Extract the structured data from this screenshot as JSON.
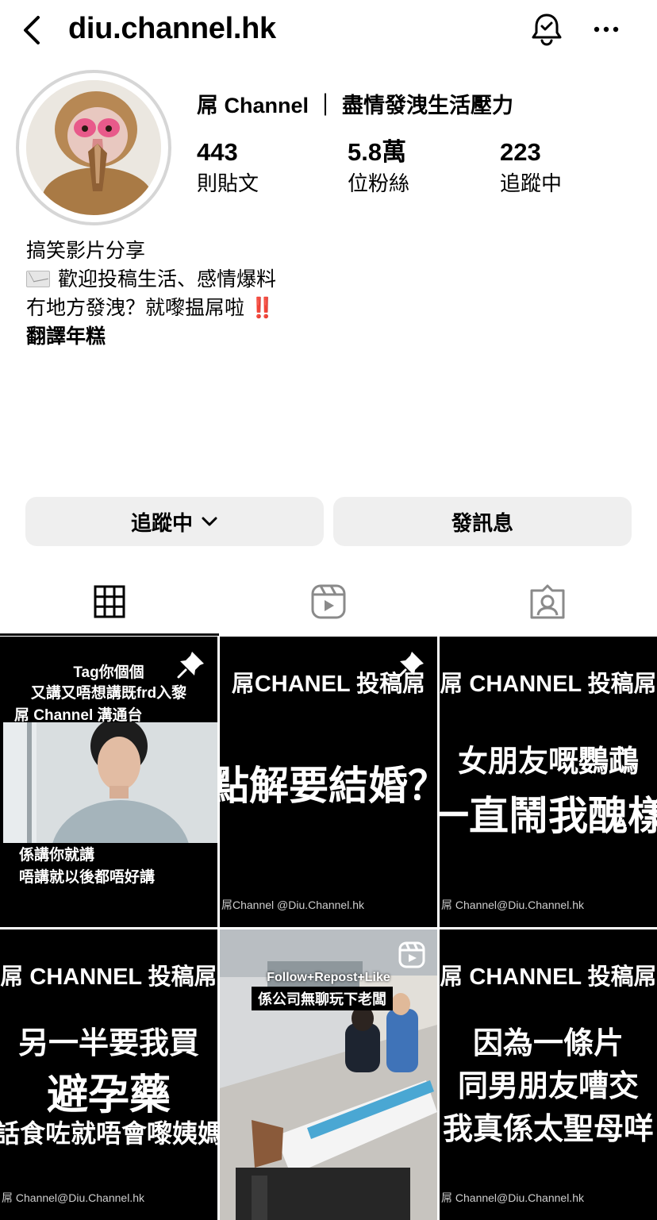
{
  "header": {
    "username": "diu.channel.hk"
  },
  "profile": {
    "display_name": "屌 Channel ｜ 盡情發洩生活壓力",
    "stats": [
      {
        "value": "443",
        "label": "則貼文"
      },
      {
        "value": "5.8萬",
        "label": "位粉絲"
      },
      {
        "value": "223",
        "label": "追蹤中"
      }
    ],
    "bio": {
      "line1": "搞笑影片分享",
      "line2": "歡迎投稿生活、感情爆料",
      "line3": "冇地方發洩？就嚟揾屌啦",
      "line3_emoji": "‼️",
      "line4": "翻譯年糕"
    }
  },
  "actions": {
    "following_label": "追蹤中",
    "message_label": "發訊息"
  },
  "tabs": {
    "icons": [
      "grid-icon",
      "reels-icon",
      "tagged-icon"
    ],
    "active": "grid-icon"
  },
  "posts": [
    {
      "top_line1": "Tag你個個",
      "top_line2": "又講又唔想講既frd入黎",
      "tag": "屌 Channel 溝通台",
      "caption1": "係講你就講",
      "caption2": "唔講就以後都唔好講",
      "pinned": true
    },
    {
      "header": "屌CHANEL 投稿屌",
      "big1": "點解要結婚？",
      "footer": "屌Channel @Diu.Channel.hk",
      "pinned": true
    },
    {
      "header": "屌 CHANNEL 投稿屌",
      "big1": "女朋友嘅鸚鵡",
      "big2": "一直鬧我醜樣",
      "footer": "屌 Channel@Diu.Channel.hk"
    },
    {
      "header": "屌 CHANNEL 投稿屌",
      "big1": "另一半要我買",
      "big2": "避孕藥",
      "big3": "話食咗就唔會嚟姨媽",
      "footer": "屌 Channel@Diu.Channel.hk"
    },
    {
      "top_line": "Follow+Repost+Like",
      "caption": "係公司無聊玩下老闆",
      "reel": true
    },
    {
      "header": "屌 CHANNEL 投稿屌",
      "big1": "因為一條片",
      "big2": "同男朋友嘈交",
      "big3": "我真係太聖母咩",
      "footer": "屌 Channel@Diu.Channel.hk"
    }
  ]
}
